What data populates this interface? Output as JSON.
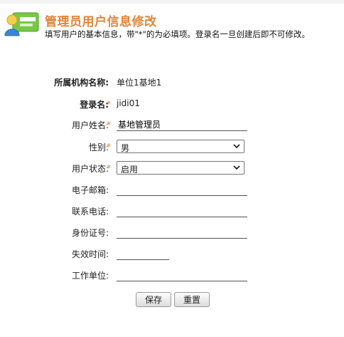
{
  "header": {
    "title": "管理员用户信息修改",
    "subtitle": "填写用户的基本信息，带\"*\"的为必填项。登录名一旦创建后即不可修改。",
    "icon": "user-card-icon"
  },
  "form": {
    "org": {
      "label": "所属机构名称:",
      "value": "单位1基地1"
    },
    "login": {
      "label": "登录名:",
      "required": "*",
      "value": "jidi01"
    },
    "username": {
      "label": "用户姓名:",
      "required": "*",
      "value": "基地管理员"
    },
    "gender": {
      "label": "性别:",
      "required": "*",
      "value": "男"
    },
    "status": {
      "label": "用户状态:",
      "required": "*",
      "value": "启用"
    },
    "email": {
      "label": "电子邮箱:",
      "value": ""
    },
    "phone": {
      "label": "联系电话:",
      "value": ""
    },
    "idcard": {
      "label": "身份证号:",
      "value": ""
    },
    "expire": {
      "label": "失效时间:",
      "value": ""
    },
    "workplace": {
      "label": "工作单位:",
      "value": ""
    }
  },
  "buttons": {
    "save": "保存",
    "reset": "重置"
  },
  "colors": {
    "accent": "#e0853a",
    "icon_green": "#6bbf3a"
  }
}
